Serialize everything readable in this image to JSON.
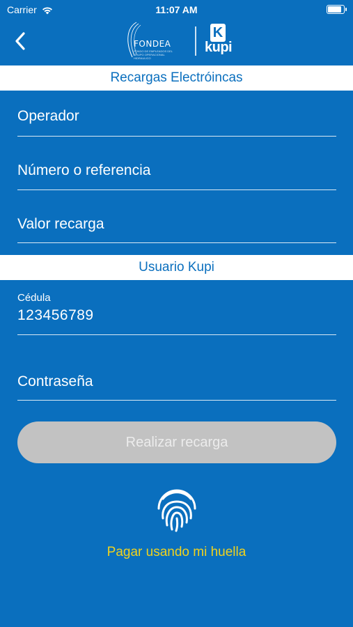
{
  "status_bar": {
    "carrier": "Carrier",
    "time": "11:07 AM",
    "wifi_icon": "wifi-icon",
    "battery_icon": "battery-icon"
  },
  "nav": {
    "back_icon": "chevron-left-icon",
    "brand_logo_text": "FONDEA",
    "brand_logo_subtext": "FONDO DE EMPLEADOS DEL GRUPO OPERACIONAL HIDRAULICO",
    "partner_logo_letter": "K",
    "partner_logo_text": "kupi"
  },
  "section_recargas": {
    "title": "Recargas Electróincas"
  },
  "fields": {
    "operador": {
      "placeholder": "Operador"
    },
    "numero": {
      "placeholder": "Número o referencia"
    },
    "valor": {
      "placeholder": "Valor recarga"
    }
  },
  "section_usuario": {
    "title": "Usuario Kupi"
  },
  "cedula": {
    "label": "Cédula",
    "value": "123456789"
  },
  "contrasena": {
    "placeholder": "Contraseña"
  },
  "submit": {
    "label": "Realizar recarga"
  },
  "fingerprint": {
    "icon": "fingerprint-icon",
    "label": "Pagar usando mi huella"
  },
  "colors": {
    "background": "#0a6fbe",
    "button_disabled": "#c2c2c2",
    "accent_yellow": "#f0d21e",
    "header_bg": "#ffffff"
  }
}
